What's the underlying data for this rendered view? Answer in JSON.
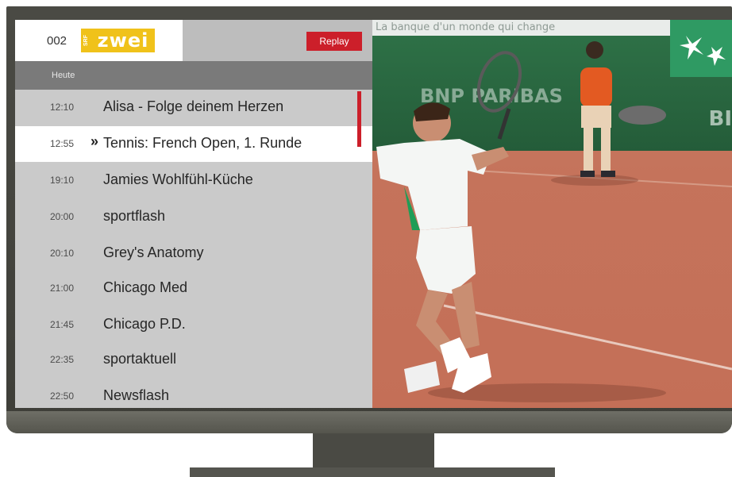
{
  "channel": {
    "number": "002",
    "logo_brand": "SRF",
    "logo_name": "zwei"
  },
  "header": {
    "replay_label": "Replay"
  },
  "day_label": "Heute",
  "programmes": [
    {
      "time": "12:10",
      "title": "Alisa - Folge deinem Herzen",
      "selected": false
    },
    {
      "time": "12:55",
      "title": "Tennis: French Open, 1. Runde",
      "selected": true
    },
    {
      "time": "19:10",
      "title": "Jamies Wohlfühl-Küche",
      "selected": false
    },
    {
      "time": "20:00",
      "title": "sportflash",
      "selected": false
    },
    {
      "time": "20:10",
      "title": "Grey's Anatomy",
      "selected": false
    },
    {
      "time": "21:00",
      "title": "Chicago Med",
      "selected": false
    },
    {
      "time": "21:45",
      "title": "Chicago P.D.",
      "selected": false
    },
    {
      "time": "22:35",
      "title": "sportaktuell",
      "selected": false
    },
    {
      "time": "22:50",
      "title": "Newsflash",
      "selected": false
    }
  ],
  "selected_marker": "»",
  "video": {
    "banner_text": "La banque d'un monde qui change",
    "sponsor_text": "BNP PARIBAS",
    "sponsor_side": "BI"
  },
  "colors": {
    "accent_red": "#cc1f2a",
    "channel_yellow": "#f0c21a"
  }
}
